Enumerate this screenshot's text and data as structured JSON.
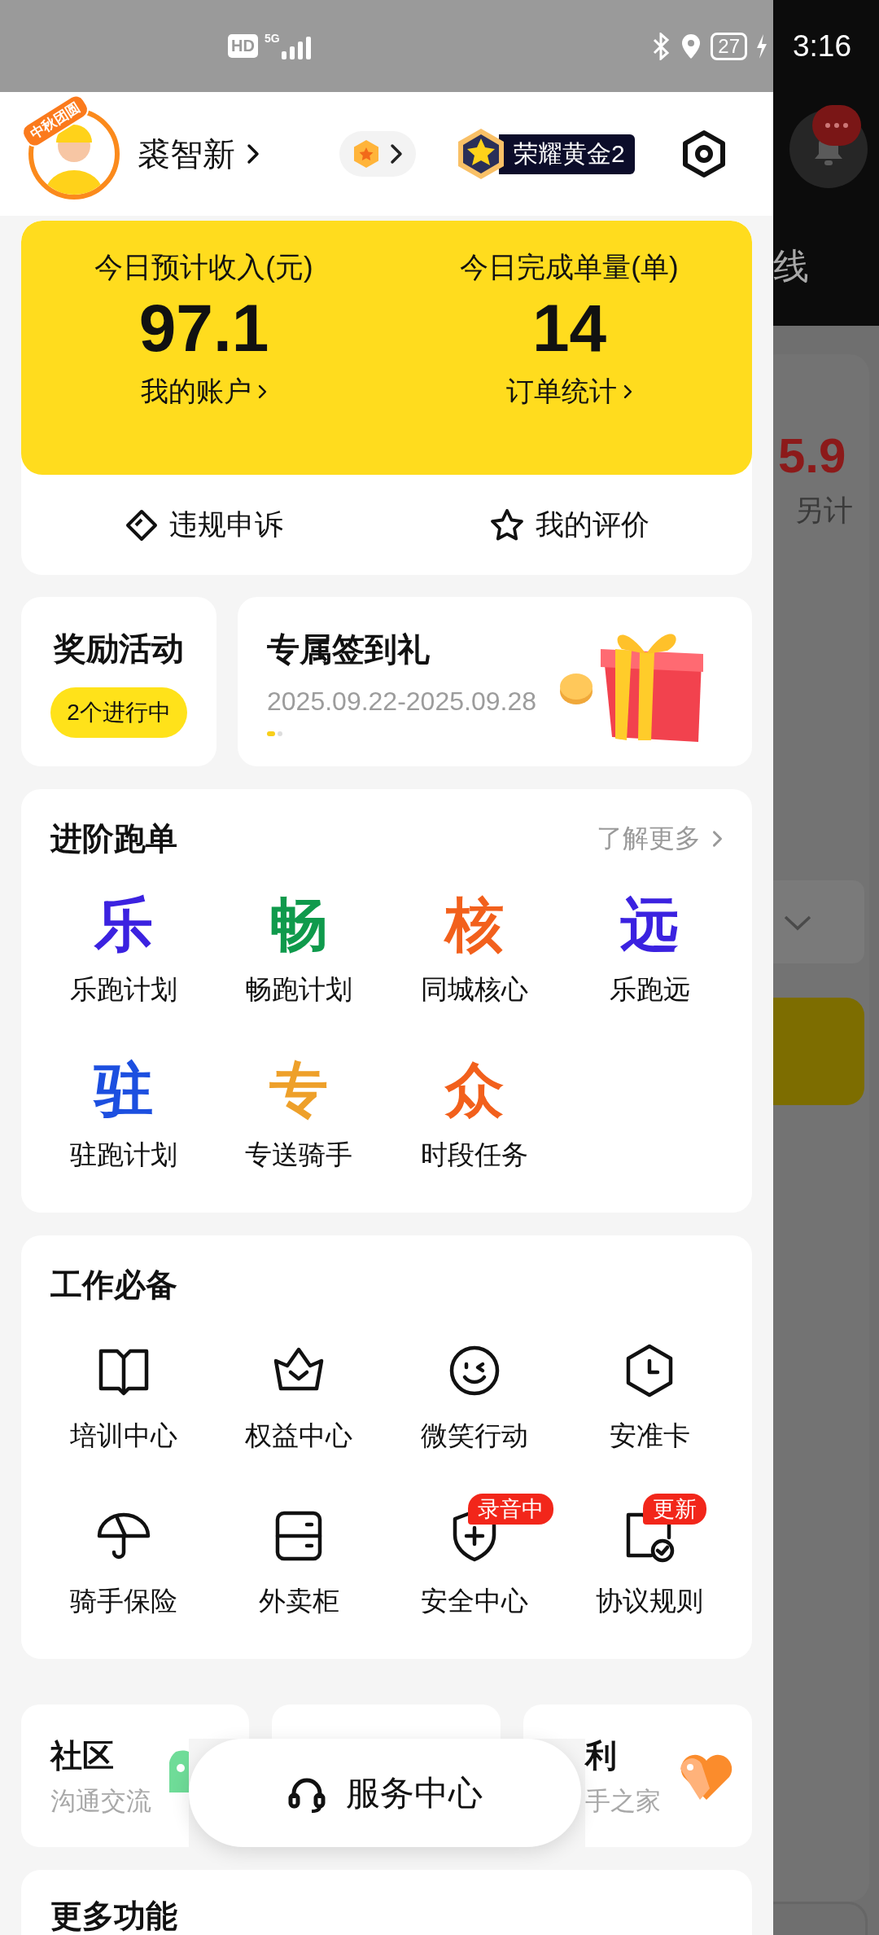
{
  "status_bar": {
    "hd": "HD",
    "network": "5G",
    "battery": "27",
    "time": "3:16"
  },
  "header": {
    "avatar_badge": "中秋团圆",
    "name": "裘智新",
    "rank": "荣耀黄金2"
  },
  "summary": {
    "stats": [
      {
        "label": "今日预计收入(元)",
        "value": "97.1",
        "link": "我的账户"
      },
      {
        "label": "今日完成单量(单)",
        "value": "14",
        "link": "订单统计"
      }
    ],
    "actions": [
      {
        "kind": "appeal",
        "label": "违规申诉"
      },
      {
        "kind": "rating",
        "label": "我的评价"
      }
    ]
  },
  "rewards": {
    "title": "奖励活动",
    "badge": "2个进行中"
  },
  "signin": {
    "title": "专属签到礼",
    "dates": "2025.09.22-2025.09.28",
    "pages": [
      {
        "selected": true
      },
      {
        "selected": false
      }
    ]
  },
  "advanced": {
    "title": "进阶跑单",
    "more": "了解更多",
    "items": [
      {
        "glyph": "乐",
        "label": "乐跑计划",
        "color": "#3b22e0"
      },
      {
        "glyph": "畅",
        "label": "畅跑计划",
        "color": "#0f9a4c"
      },
      {
        "glyph": "核",
        "label": "同城核心",
        "color": "#f2601c"
      },
      {
        "glyph": "远",
        "label": "乐跑远",
        "color": "#3b22e0"
      },
      {
        "glyph": "驻",
        "label": "驻跑计划",
        "color": "#1c4fe0"
      },
      {
        "glyph": "专",
        "label": "专送骑手",
        "color": "#eea02a"
      },
      {
        "glyph": "众",
        "label": "时段任务",
        "color": "#f2601c"
      }
    ]
  },
  "work": {
    "title": "工作必备",
    "items": [
      {
        "kind": "book",
        "label": "培训中心"
      },
      {
        "kind": "crown",
        "label": "权益中心"
      },
      {
        "kind": "smile",
        "label": "微笑行动"
      },
      {
        "kind": "clock",
        "label": "安准卡"
      },
      {
        "kind": "umbrella",
        "label": "骑手保险"
      },
      {
        "kind": "cabinet",
        "label": "外卖柜"
      },
      {
        "kind": "shield",
        "label": "安全中心",
        "badge": "录音中"
      },
      {
        "kind": "document",
        "label": "协议规则",
        "badge": "更新"
      }
    ]
  },
  "bottom_cards": [
    {
      "kind": "community",
      "title": "社区",
      "subtitle": "沟通交流"
    },
    {
      "kind": "blank"
    },
    {
      "kind": "welfare",
      "title": "利",
      "subtitle": "手之家"
    }
  ],
  "service_button": {
    "label": "服务中心"
  },
  "more": {
    "title": "更多功能"
  },
  "backdrop": {
    "route": "线",
    "amount": "5.9",
    "note": "另计"
  }
}
